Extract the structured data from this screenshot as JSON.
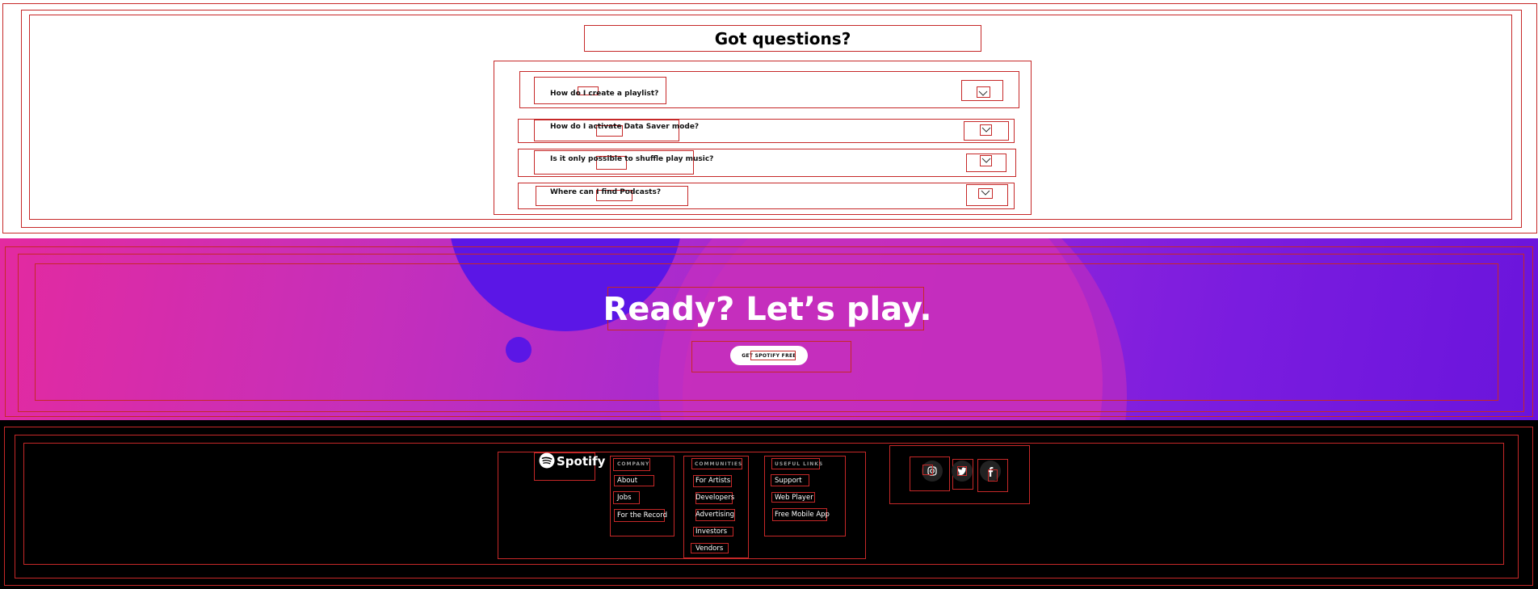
{
  "faq": {
    "title": "Got questions?",
    "items": [
      {
        "question": "How do I create a playlist?"
      },
      {
        "question": "How do I activate Data Saver mode?"
      },
      {
        "question": "Is it only possible to shuffle play music?"
      },
      {
        "question": "Where can I find Podcasts?"
      }
    ]
  },
  "hero": {
    "title": "Ready? Let’s play.",
    "cta_label": "GET SPOTIFY FREE"
  },
  "footer": {
    "logo_text": "Spotify",
    "columns": [
      {
        "heading": "COMPANY",
        "links": [
          "About",
          "Jobs",
          "For the Record"
        ]
      },
      {
        "heading": "COMMUNITIES",
        "links": [
          "For Artists",
          "Developers",
          "Advertising",
          "Investors",
          "Vendors"
        ]
      },
      {
        "heading": "USEFUL LINKS",
        "links": [
          "Support",
          "Web Player",
          "Free Mobile App"
        ]
      }
    ],
    "social": [
      {
        "icon": "instagram-icon"
      },
      {
        "icon": "twitter-icon"
      },
      {
        "icon": "facebook-icon"
      }
    ]
  },
  "colors": {
    "outline": "#c62828",
    "hero_start": "#e32aa0",
    "hero_end": "#6a14dc",
    "hero_circle": "#5b16e6",
    "footer_bg": "#000000"
  }
}
